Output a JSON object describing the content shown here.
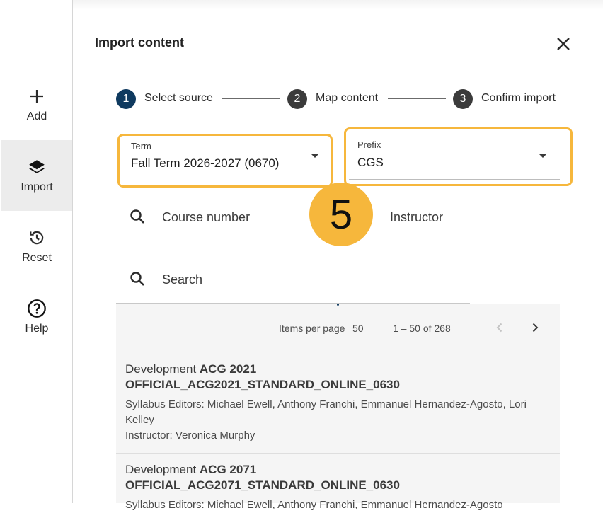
{
  "sidebar": {
    "items": [
      {
        "label": "Add",
        "icon": "plus-icon",
        "active": false
      },
      {
        "label": "Import",
        "icon": "layers-icon",
        "active": true
      },
      {
        "label": "Reset",
        "icon": "history-icon",
        "active": false
      },
      {
        "label": "Help",
        "icon": "help-circle-icon",
        "active": false
      }
    ]
  },
  "panel": {
    "title": "Import content",
    "close_icon": "close-icon"
  },
  "stepper": {
    "steps": [
      {
        "number": "1",
        "label": "Select source",
        "active": true
      },
      {
        "number": "2",
        "label": "Map content",
        "active": false
      },
      {
        "number": "3",
        "label": "Confirm import",
        "active": false
      }
    ]
  },
  "filters": {
    "term": {
      "label": "Term",
      "value": "Fall Term 2026-2027 (0670)"
    },
    "prefix": {
      "label": "Prefix",
      "value": "CGS"
    },
    "course_number": {
      "placeholder": "Course number"
    },
    "instructor": {
      "placeholder": "Instructor"
    },
    "search": {
      "placeholder": "Search"
    }
  },
  "callout_badge": "5",
  "pagination": {
    "items_per_page_label": "Items per page",
    "items_per_page_value": "50",
    "range": "1 – 50 of 268"
  },
  "results": [
    {
      "prefix_text": "Development",
      "course": "ACG 2021",
      "code": "OFFICIAL_ACG2021_STANDARD_ONLINE_0630",
      "editors": "Syllabus Editors: Michael Ewell, Anthony Franchi, Emmanuel Hernandez-Agosto, Lori Kelley",
      "instructor": "Instructor: Veronica Murphy"
    },
    {
      "prefix_text": "Development",
      "course": "ACG 2071",
      "code": "OFFICIAL_ACG2071_STANDARD_ONLINE_0630",
      "editors": "Syllabus Editors: Michael Ewell, Anthony Franchi, Emmanuel Hernandez-Agosto"
    }
  ],
  "colors": {
    "highlight": "#f6b73c",
    "step_active": "#0f3a5f",
    "step_inactive": "#3b3b3b"
  }
}
